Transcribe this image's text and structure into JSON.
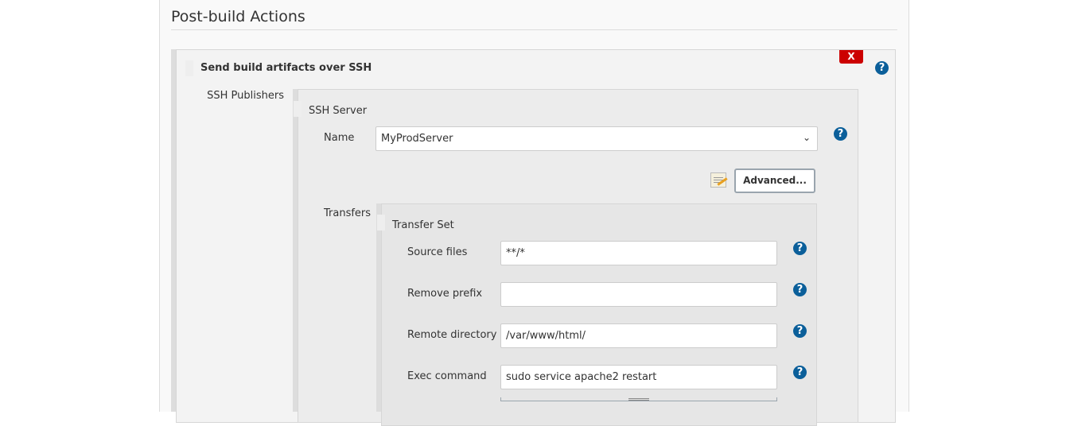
{
  "section_title": "Post-build Actions",
  "step": {
    "title": "Send build artifacts over SSH",
    "delete_label": "X",
    "publishers_label": "SSH Publishers"
  },
  "server": {
    "title": "SSH Server",
    "name_label": "Name",
    "name_value": "MyProdServer",
    "advanced_label": "Advanced...",
    "transfers_label": "Transfers"
  },
  "transfer": {
    "title": "Transfer Set",
    "fields": [
      {
        "label": "Source files",
        "value": "**/*"
      },
      {
        "label": "Remove prefix",
        "value": ""
      },
      {
        "label": "Remote directory",
        "value": "/var/www/html/"
      },
      {
        "label": "Exec command",
        "value": "sudo service apache2 restart"
      }
    ]
  },
  "help_glyph": "?"
}
